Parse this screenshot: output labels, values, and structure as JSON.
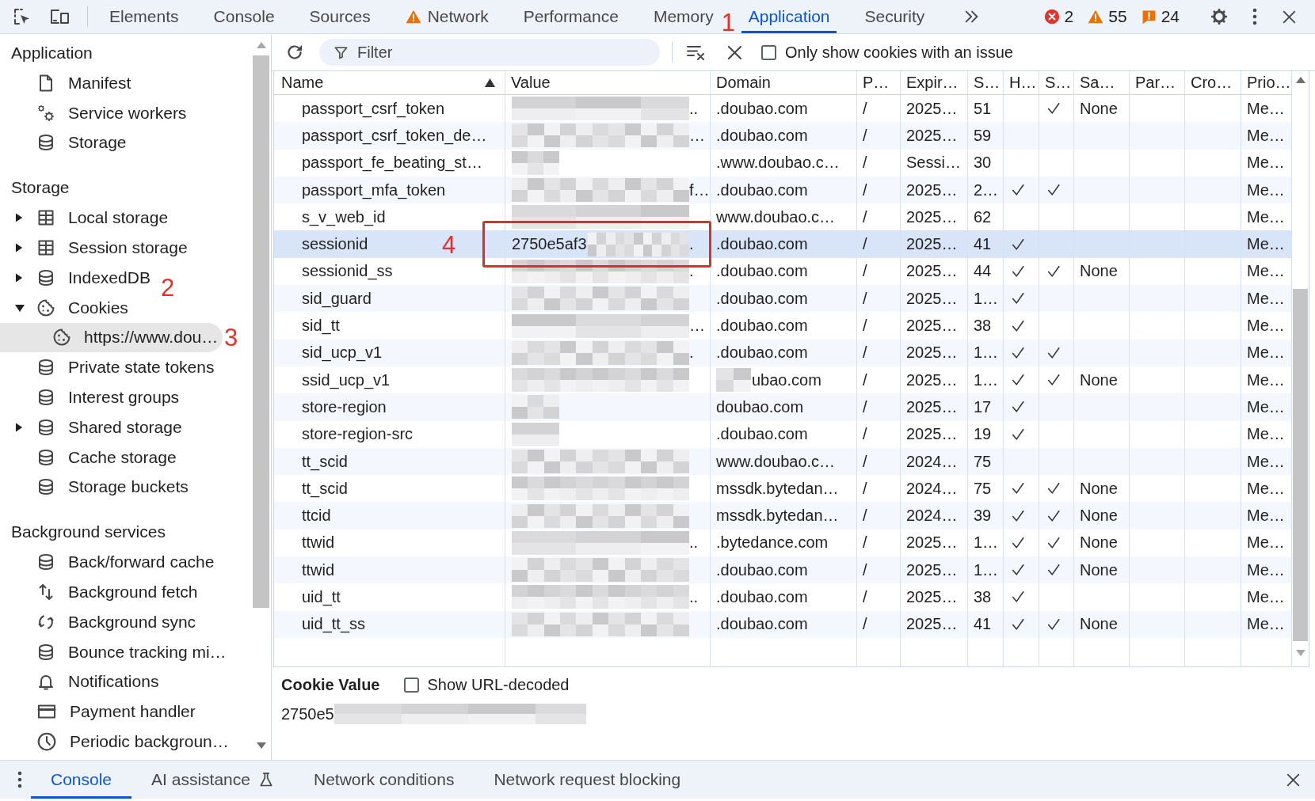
{
  "toolbar": {
    "tabs": [
      {
        "label": "Elements",
        "selected": false,
        "warning": false
      },
      {
        "label": "Console",
        "selected": false,
        "warning": false
      },
      {
        "label": "Sources",
        "selected": false,
        "warning": false
      },
      {
        "label": "Network",
        "selected": false,
        "warning": true
      },
      {
        "label": "Performance",
        "selected": false,
        "warning": false
      },
      {
        "label": "Memory",
        "selected": false,
        "warning": false
      },
      {
        "label": "Application",
        "selected": true,
        "warning": false,
        "annotation": "1"
      },
      {
        "label": "Security",
        "selected": false,
        "warning": false
      }
    ],
    "counters": [
      {
        "kind": "error",
        "count": "2"
      },
      {
        "kind": "warning",
        "count": "55"
      },
      {
        "kind": "issue",
        "count": "24"
      }
    ]
  },
  "sidebar": {
    "sections": [
      {
        "title": "Application",
        "items": [
          {
            "label": "Manifest",
            "kind": "manifest",
            "selected": false
          },
          {
            "label": "Service workers",
            "kind": "service-workers",
            "selected": false
          },
          {
            "label": "Storage",
            "kind": "storage",
            "selected": false
          }
        ]
      },
      {
        "title": "Storage",
        "items": [
          {
            "label": "Local storage",
            "kind": "key-value",
            "expanded": false,
            "selected": false
          },
          {
            "label": "Session storage",
            "kind": "key-value",
            "expanded": false,
            "selected": false
          },
          {
            "label": "IndexedDB",
            "kind": "database",
            "expanded": false,
            "selected": false
          },
          {
            "label": "Cookies",
            "kind": "cookies",
            "expanded": true,
            "selected": false,
            "annotation": "2",
            "children": [
              {
                "label": "https://www.dou…",
                "kind": "cookies",
                "selected": true,
                "annotation": "3"
              }
            ]
          },
          {
            "label": "Private state tokens",
            "kind": "database",
            "selected": false
          },
          {
            "label": "Interest groups",
            "kind": "database",
            "selected": false
          },
          {
            "label": "Shared storage",
            "kind": "database",
            "expanded": false,
            "selected": false
          },
          {
            "label": "Cache storage",
            "kind": "database",
            "selected": false
          },
          {
            "label": "Storage buckets",
            "kind": "database",
            "selected": false
          }
        ]
      },
      {
        "title": "Background services",
        "items": [
          {
            "label": "Back/forward cache",
            "kind": "database",
            "selected": false
          },
          {
            "label": "Background fetch",
            "kind": "fetch",
            "selected": false
          },
          {
            "label": "Background sync",
            "kind": "sync",
            "selected": false
          },
          {
            "label": "Bounce tracking mi…",
            "kind": "database",
            "selected": false
          },
          {
            "label": "Notifications",
            "kind": "notifications",
            "selected": false
          },
          {
            "label": "Payment handler",
            "kind": "payment",
            "selected": false
          },
          {
            "label": "Periodic backgroun…",
            "kind": "periodic",
            "selected": false
          }
        ]
      }
    ]
  },
  "cookie_toolbar": {
    "filter": {
      "placeholder": "Filter"
    },
    "issue_filter": {
      "label": "Only show cookies with an issue",
      "checked": false
    }
  },
  "table": {
    "columns": [
      {
        "label": "Name",
        "sorted": true
      },
      {
        "label": "Value",
        "sorted": false
      },
      {
        "label": "Domain",
        "sorted": false
      },
      {
        "label": "P…",
        "sorted": false
      },
      {
        "label": "Expir…",
        "sorted": false
      },
      {
        "label": "S…",
        "sorted": false
      },
      {
        "label": "H…",
        "sorted": false
      },
      {
        "label": "S…",
        "sorted": false
      },
      {
        "label": "Sa…",
        "sorted": false
      },
      {
        "label": "Par…",
        "sorted": false
      },
      {
        "label": "Cro…",
        "sorted": false
      },
      {
        "label": "Prio…",
        "sorted": false
      }
    ],
    "rows": [
      {
        "name": "passport_csrf_token",
        "value": {
          "kind": "long",
          "tail": ".."
        },
        "domain": ".doubao.com",
        "domain_blurred": false,
        "path": "/",
        "expires": "2025…",
        "size": "51",
        "http_only": false,
        "secure": true,
        "same_site": "None",
        "priority": "Me…",
        "selected": false,
        "boxed": false
      },
      {
        "name": "passport_csrf_token_de…",
        "value": {
          "kind": "long",
          "tail": "…"
        },
        "domain": ".doubao.com",
        "domain_blurred": false,
        "path": "/",
        "expires": "2025…",
        "size": "59",
        "http_only": false,
        "secure": false,
        "priority": "Me…",
        "selected": false,
        "boxed": false
      },
      {
        "name": "passport_fe_beating_st…",
        "value": {
          "kind": "short"
        },
        "domain": ".www.doubao.c…",
        "domain_blurred": false,
        "path": "/",
        "expires": "Sessi…",
        "size": "30",
        "http_only": false,
        "secure": false,
        "priority": "Me…",
        "selected": false,
        "boxed": false
      },
      {
        "name": "passport_mfa_token",
        "value": {
          "kind": "long",
          "tail": "f…"
        },
        "domain": ".doubao.com",
        "domain_blurred": false,
        "path": "/",
        "expires": "2025…",
        "size": "2…",
        "http_only": true,
        "secure": true,
        "priority": "Me…",
        "selected": false,
        "boxed": false
      },
      {
        "name": "s_v_web_id",
        "value": {
          "kind": "long"
        },
        "domain": "www.doubao.c…",
        "domain_blurred": false,
        "path": "/",
        "expires": "2025…",
        "size": "62",
        "http_only": false,
        "secure": false,
        "priority": "Me…",
        "selected": false,
        "boxed": false
      },
      {
        "name": "sessionid",
        "annotation": "4",
        "value": {
          "kind": "long",
          "shown": "2750e5af3",
          "tail": "."
        },
        "domain": ".doubao.com",
        "domain_blurred": false,
        "path": "/",
        "expires": "2025…",
        "size": "41",
        "http_only": true,
        "secure": false,
        "priority": "Me…",
        "selected": true,
        "boxed": true
      },
      {
        "name": "sessionid_ss",
        "value": {
          "kind": "long",
          "tail": "."
        },
        "domain": ".doubao.com",
        "domain_blurred": false,
        "path": "/",
        "expires": "2025…",
        "size": "44",
        "http_only": true,
        "secure": true,
        "same_site": "None",
        "priority": "Me…",
        "selected": false,
        "boxed": false
      },
      {
        "name": "sid_guard",
        "value": {
          "kind": "long"
        },
        "domain": ".doubao.com",
        "domain_blurred": false,
        "path": "/",
        "expires": "2025…",
        "size": "1…",
        "http_only": true,
        "secure": false,
        "priority": "Me…",
        "selected": false,
        "boxed": false
      },
      {
        "name": "sid_tt",
        "value": {
          "kind": "long",
          "tail": "…"
        },
        "domain": ".doubao.com",
        "domain_blurred": false,
        "path": "/",
        "expires": "2025…",
        "size": "38",
        "http_only": true,
        "secure": false,
        "priority": "Me…",
        "selected": false,
        "boxed": false
      },
      {
        "name": "sid_ucp_v1",
        "value": {
          "kind": "long",
          "tail": "."
        },
        "domain": ".doubao.com",
        "domain_blurred": false,
        "path": "/",
        "expires": "2025…",
        "size": "1…",
        "http_only": true,
        "secure": true,
        "priority": "Me…",
        "selected": false,
        "boxed": false
      },
      {
        "name": "ssid_ucp_v1",
        "value": {
          "kind": "long"
        },
        "domain": "ubao.com",
        "domain_blurred": true,
        "path": "/",
        "expires": "2025…",
        "size": "1…",
        "http_only": true,
        "secure": true,
        "same_site": "None",
        "priority": "Me…",
        "selected": false,
        "boxed": false
      },
      {
        "name": "store-region",
        "value": {
          "kind": "short"
        },
        "domain": "doubao.com",
        "domain_blurred": false,
        "path": "/",
        "expires": "2025…",
        "size": "17",
        "http_only": true,
        "secure": false,
        "priority": "Me…",
        "selected": false,
        "boxed": false
      },
      {
        "name": "store-region-src",
        "value": {
          "kind": "short"
        },
        "domain": ".doubao.com",
        "domain_blurred": false,
        "path": "/",
        "expires": "2025…",
        "size": "19",
        "http_only": true,
        "secure": false,
        "priority": "Me…",
        "selected": false,
        "boxed": false
      },
      {
        "name": "tt_scid",
        "value": {
          "kind": "long"
        },
        "domain": "www.doubao.c…",
        "domain_blurred": false,
        "path": "/",
        "expires": "2024…",
        "size": "75",
        "http_only": false,
        "secure": false,
        "priority": "Me…",
        "selected": false,
        "boxed": false
      },
      {
        "name": "tt_scid",
        "value": {
          "kind": "long"
        },
        "domain": "mssdk.bytedan…",
        "domain_blurred": false,
        "path": "/",
        "expires": "2024…",
        "size": "75",
        "http_only": true,
        "secure": true,
        "same_site": "None",
        "priority": "Me…",
        "selected": false,
        "boxed": false
      },
      {
        "name": "ttcid",
        "value": {
          "kind": "long"
        },
        "domain": "mssdk.bytedan…",
        "domain_blurred": false,
        "path": "/",
        "expires": "2024…",
        "size": "39",
        "http_only": true,
        "secure": true,
        "same_site": "None",
        "priority": "Me…",
        "selected": false,
        "boxed": false
      },
      {
        "name": "ttwid",
        "value": {
          "kind": "long",
          "tail": ".."
        },
        "domain": ".bytedance.com",
        "domain_blurred": false,
        "path": "/",
        "expires": "2025…",
        "size": "1…",
        "http_only": true,
        "secure": true,
        "same_site": "None",
        "priority": "Me…",
        "selected": false,
        "boxed": false
      },
      {
        "name": "ttwid",
        "value": {
          "kind": "long"
        },
        "domain": ".doubao.com",
        "domain_blurred": false,
        "path": "/",
        "expires": "2025…",
        "size": "1…",
        "http_only": true,
        "secure": true,
        "same_site": "None",
        "priority": "Me…",
        "selected": false,
        "boxed": false
      },
      {
        "name": "uid_tt",
        "value": {
          "kind": "long",
          "tail": ".."
        },
        "domain": ".doubao.com",
        "domain_blurred": false,
        "path": "/",
        "expires": "2025…",
        "size": "38",
        "http_only": true,
        "secure": false,
        "priority": "Me…",
        "selected": false,
        "boxed": false
      },
      {
        "name": "uid_tt_ss",
        "value": {
          "kind": "long"
        },
        "domain": ".doubao.com",
        "domain_blurred": false,
        "path": "/",
        "expires": "2025…",
        "size": "41",
        "http_only": true,
        "secure": true,
        "same_site": "None",
        "priority": "Me…",
        "selected": false,
        "boxed": false
      }
    ]
  },
  "cookie_value": {
    "title": "Cookie Value",
    "url_decoded": {
      "label": "Show URL-decoded",
      "checked": false
    },
    "shown": "2750e5"
  },
  "drawer": {
    "tabs": [
      {
        "label": "Console",
        "selected": true,
        "experimental": false
      },
      {
        "label": "AI assistance",
        "selected": false,
        "experimental": true
      },
      {
        "label": "Network conditions",
        "selected": false,
        "experimental": false
      },
      {
        "label": "Network request blocking",
        "selected": false,
        "experimental": false
      }
    ]
  }
}
